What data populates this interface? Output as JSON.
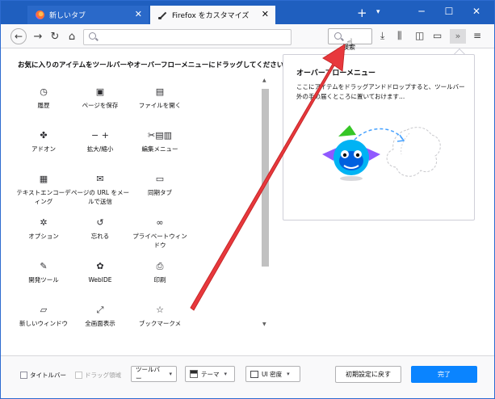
{
  "tabs": [
    {
      "label": "新しいタブ",
      "icon": "firefox-icon"
    },
    {
      "label": "Firefox をカスタマイズ",
      "icon": "paintbrush-icon"
    }
  ],
  "window_controls": {
    "minimize": "─",
    "maximize": "☐",
    "close": "✕"
  },
  "toolbar": {
    "back": "←",
    "forward": "→",
    "reload": "↻",
    "home": "⌂",
    "search_label": "検索",
    "overflow": "»",
    "menu": "≡"
  },
  "instruction": "お気に入りのアイテムをツールバーやオーバーフローメニューにドラッグしてください。",
  "palette": [
    {
      "icon": "history-icon",
      "glyph": "◷",
      "label": "履歴"
    },
    {
      "icon": "save-page-icon",
      "glyph": "▣",
      "label": "ページを保存"
    },
    {
      "icon": "open-file-icon",
      "glyph": "▤",
      "label": "ファイルを開く"
    },
    {
      "icon": "addons-icon",
      "glyph": "✤",
      "label": "アドオン"
    },
    {
      "icon": "zoom-icon",
      "glyph": "− +",
      "label": "拡大/縮小"
    },
    {
      "icon": "edit-icon",
      "glyph": "✂▤▥",
      "label": "編集メニュー"
    },
    {
      "icon": "text-encoding-icon",
      "glyph": "▦",
      "label": "テキストエンコーディング"
    },
    {
      "icon": "email-link-icon",
      "glyph": "✉",
      "label": "ページの URL をメールで送信"
    },
    {
      "icon": "synced-tabs-icon",
      "glyph": "▭",
      "label": "同期タブ"
    },
    {
      "icon": "options-icon",
      "glyph": "✲",
      "label": "オプション"
    },
    {
      "icon": "forget-icon",
      "glyph": "↺",
      "label": "忘れる"
    },
    {
      "icon": "private-window-icon",
      "glyph": "∞",
      "label": "プライベートウィンドウ"
    },
    {
      "icon": "developer-icon",
      "glyph": "✎",
      "label": "開発ツール"
    },
    {
      "icon": "webide-icon",
      "glyph": "✿",
      "label": "WebIDE"
    },
    {
      "icon": "print-icon",
      "glyph": "⎙",
      "label": "印刷"
    },
    {
      "icon": "new-window-icon",
      "glyph": "▱",
      "label": "新しいウィンドウ"
    },
    {
      "icon": "fullscreen-icon",
      "glyph": "⤢",
      "label": "全画面表示"
    },
    {
      "icon": "bookmarks-menu-icon",
      "glyph": "☆",
      "label": "ブックマークメ"
    }
  ],
  "overflow_panel": {
    "title": "オーバーフローメニュー",
    "description": "ここにアイテムをドラッグアンドドロップすると、ツールバー外の手の届くところに置いておけます..."
  },
  "footer": {
    "titlebar_label": "タイトルバー",
    "drag_space_label": "ドラッグ領域",
    "toolbars_label": "ツールバー",
    "themes_label": "テーマ",
    "density_label": "UI 密度",
    "reset_label": "初期設定に戻す",
    "done_label": "完了"
  },
  "colors": {
    "tab_bar": "#1f5fbf",
    "accent": "#0a84ff",
    "annotation": "#e8383d"
  }
}
